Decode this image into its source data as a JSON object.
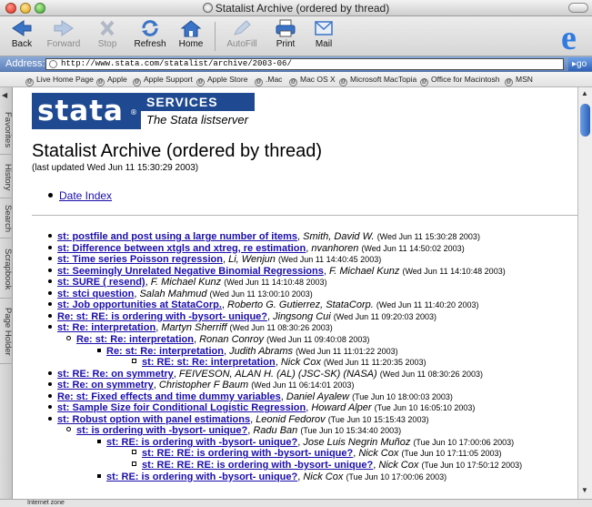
{
  "window": {
    "title": "Statalist Archive (ordered by thread)"
  },
  "toolbar": {
    "back": "Back",
    "forward": "Forward",
    "stop": "Stop",
    "refresh": "Refresh",
    "home": "Home",
    "autofill": "AutoFill",
    "print": "Print",
    "mail": "Mail"
  },
  "address": {
    "label": "Address:",
    "url": "http://www.stata.com/statalist/archive/2003-06/",
    "go": "go"
  },
  "favorites": [
    "Live Home Page",
    "Apple",
    "Apple Support",
    "Apple Store",
    ".Mac",
    "Mac OS X",
    "Microsoft MacTopia",
    "Office for Macintosh",
    "MSN"
  ],
  "sidebar": {
    "tabs": [
      "Favorites",
      "History",
      "Search",
      "Scrapbook",
      "Page Holder"
    ]
  },
  "banner": {
    "logo": "stata",
    "services": "SERVICES",
    "tagline": "The Stata listserver"
  },
  "page": {
    "heading": "Statalist Archive (ordered by thread)",
    "updated": "(last updated Wed Jun 11 15:30:29 2003)",
    "date_index": "Date Index"
  },
  "threads": [
    {
      "level": 0,
      "subject": "st: postfile and post using a large number of items",
      "author": "Smith, David W.",
      "date": "(Wed Jun 11 15:30:28 2003)"
    },
    {
      "level": 0,
      "subject": "st: Difference between xtgls and xtreg, re estimation",
      "author": "nvanhoren",
      "date": "(Wed Jun 11 14:50:02 2003)"
    },
    {
      "level": 0,
      "subject": "st: Time series Poisson regression",
      "author": "Li, Wenjun",
      "date": "(Wed Jun 11 14:40:45 2003)"
    },
    {
      "level": 0,
      "subject": "st: Seemingly Unrelated Negative Binomial Regressions",
      "author": "F. Michael Kunz",
      "date": "(Wed Jun 11 14:10:48 2003)"
    },
    {
      "level": 0,
      "subject": "st: SURE ( resend)",
      "author": "F. Michael Kunz",
      "date": "(Wed Jun 11 14:10:48 2003)"
    },
    {
      "level": 0,
      "subject": "st: stci question",
      "author": "Salah Mahmud",
      "date": "(Wed Jun 11 13:00:10 2003)"
    },
    {
      "level": 0,
      "subject": "st: Job opportunities at StataCorp.",
      "author": "Roberto G. Gutierrez, StataCorp.",
      "date": "(Wed Jun 11 11:40:20 2003)"
    },
    {
      "level": 0,
      "subject": "Re: st: RE: is ordering with -bysort- unique?",
      "author": "Jingsong Cui",
      "date": "(Wed Jun 11 09:20:03 2003)"
    },
    {
      "level": 0,
      "subject": "st: Re: interpretation",
      "author": "Martyn Sherriff",
      "date": "(Wed Jun 11 08:30:26 2003)"
    },
    {
      "level": 1,
      "subject": "Re: st: Re: interpretation",
      "author": "Ronan Conroy",
      "date": "(Wed Jun 11 09:40:08 2003)"
    },
    {
      "level": 2,
      "subject": "Re: st: Re: interpretation",
      "author": "Judith Abrams",
      "date": "(Wed Jun 11 11:01:22 2003)"
    },
    {
      "level": 3,
      "subject": "st: RE: st: Re: interpretation",
      "author": "Nick Cox",
      "date": "(Wed Jun 11 11:20:35 2003)"
    },
    {
      "level": 0,
      "subject": "st: RE: Re: on symmetry",
      "author": "FEIVESON, ALAN H. (AL) (JSC-SK) (NASA)",
      "date": "(Wed Jun 11 08:30:26 2003)"
    },
    {
      "level": 0,
      "subject": "st: Re: on symmetry",
      "author": "Christopher F Baum",
      "date": "(Wed Jun 11 06:14:01 2003)"
    },
    {
      "level": 0,
      "subject": "Re: st: Fixed effects and time dummy variables",
      "author": "Daniel Ayalew",
      "date": "(Tue Jun 10 18:00:03 2003)"
    },
    {
      "level": 0,
      "subject": "st: Sample Size foir Conditional Logistic Regression",
      "author": "Howard Alper",
      "date": "(Tue Jun 10 16:05:10 2003)"
    },
    {
      "level": 0,
      "subject": "st: Robust option with panel estimations",
      "author": "Leonid Fedorov",
      "date": "(Tue Jun 10 15:15:43 2003)"
    },
    {
      "level": 1,
      "subject": "st: is ordering with -bysort- unique?",
      "author": "Radu Ban",
      "date": "(Tue Jun 10 15:34:40 2003)"
    },
    {
      "level": 2,
      "subject": "st: RE: is ordering with -bysort- unique?",
      "author": "Jose Luis Negrin Muñoz",
      "date": "(Tue Jun 10 17:00:06 2003)"
    },
    {
      "level": 3,
      "subject": "st: RE: RE: is ordering with -bysort- unique?",
      "author": "Nick Cox",
      "date": "(Tue Jun 10 17:11:05 2003)"
    },
    {
      "level": 3,
      "subject": "st: RE: RE: RE: is ordering with -bysort- unique?",
      "author": "Nick Cox",
      "date": "(Tue Jun 10 17:50:12 2003)"
    },
    {
      "level": 2,
      "subject": "st: RE: is ordering with -bysort- unique?",
      "author": "Nick Cox",
      "date": "(Tue Jun 10 17:00:06 2003)"
    }
  ],
  "status": {
    "zone": "Internet zone"
  }
}
